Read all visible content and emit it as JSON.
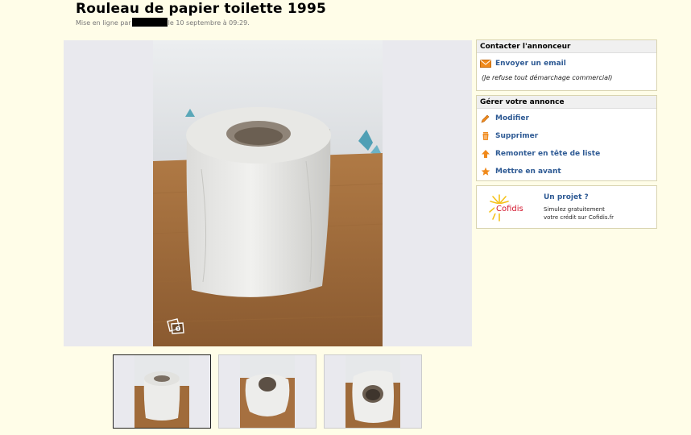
{
  "listing": {
    "title": "Rouleau de papier toilette 1995",
    "posted_prefix": "Mise en ligne par",
    "posted_suffix": "le 10 septembre à 09:29."
  },
  "contact_box": {
    "header": "Contacter l'annonceur",
    "email_label": "Envoyer un email",
    "note": "(Je refuse tout démarchage commercial)"
  },
  "manage_box": {
    "header": "Gérer votre annonce",
    "items": [
      {
        "label": "Modifier",
        "icon": "pencil-icon"
      },
      {
        "label": "Supprimer",
        "icon": "trash-icon"
      },
      {
        "label": "Remonter en tête de liste",
        "icon": "arrow-up-icon"
      },
      {
        "label": "Mettre en avant",
        "icon": "star-icon"
      }
    ]
  },
  "promo": {
    "brand": "Cofidis",
    "title": "Un projet ?",
    "line1": "Simulez gratuitement",
    "line2": "votre crédit sur Cofidis.fr"
  },
  "gallery": {
    "thumbnail_count": 3,
    "selected_index": 0
  },
  "colors": {
    "page_bg": "#fffde8",
    "link": "#2e5a94",
    "accent_orange": "#f08a1c",
    "cofidis_red": "#d3172e"
  }
}
